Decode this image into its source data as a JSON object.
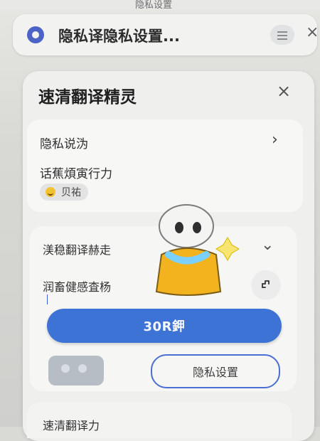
{
  "status_top": "隐私设置",
  "topbar": {
    "title": "隐私译隐私设置...",
    "menu_icon": "menu-icon",
    "close_icon": "close-icon"
  },
  "panel": {
    "title": "速清翻译精灵",
    "close_icon": "close-icon"
  },
  "privacy_card": {
    "row1": "隐私说沩",
    "chevron_icon": "chevron-right-icon",
    "row2": "话蕉煩寅行力",
    "badge": "贝祐"
  },
  "translate_card": {
    "header": "渼稳翻译赫走",
    "dropdown_icon": "chevron-down-icon",
    "label": "润畜健感査杨",
    "action_icon": "edit-icon"
  },
  "primary_button": "30R鉀",
  "secondary_button": "隐私设置",
  "bottom_card": "速清翻译力",
  "colors": {
    "accent": "#3e73d6",
    "outline": "#4b6fd4",
    "panel": "#efefed"
  }
}
